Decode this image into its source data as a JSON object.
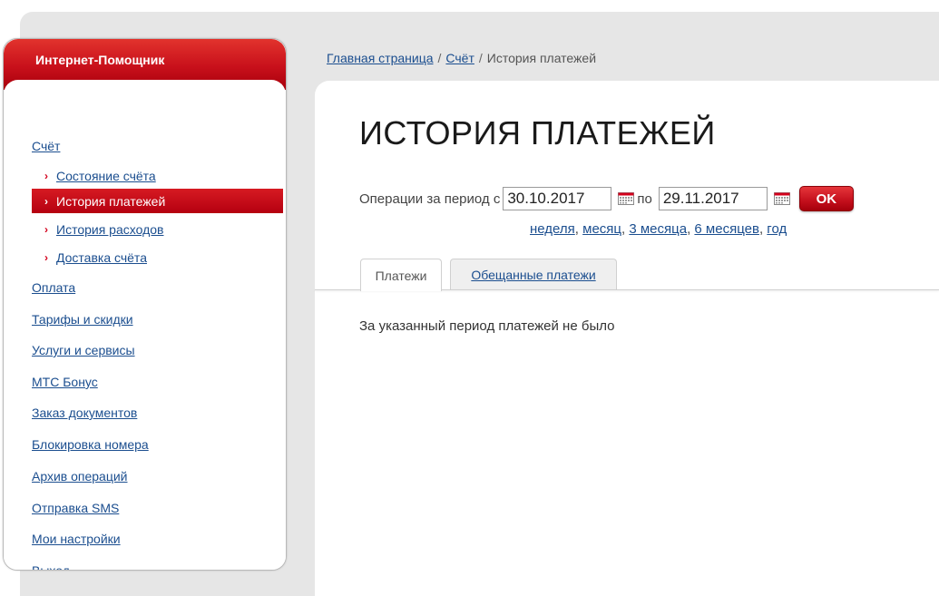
{
  "sidebar": {
    "title": "Интернет-Помощник",
    "items": [
      {
        "label": "Счёт"
      },
      {
        "label": "Оплата"
      },
      {
        "label": "Тарифы и скидки"
      },
      {
        "label": "Услуги и сервисы"
      },
      {
        "label": "МТС Бонус"
      },
      {
        "label": "Заказ документов"
      },
      {
        "label": "Блокировка номера"
      },
      {
        "label": "Архив операций"
      },
      {
        "label": "Отправка SMS"
      },
      {
        "label": "Мои настройки"
      },
      {
        "label": "Выход"
      }
    ],
    "sub_items": [
      {
        "label": "Состояние счёта",
        "active": false
      },
      {
        "label": "История платежей",
        "active": true
      },
      {
        "label": "История расходов",
        "active": false
      },
      {
        "label": "Доставка счёта",
        "active": false
      }
    ],
    "arrow_glyph": "›"
  },
  "breadcrumb": {
    "home": "Главная страница",
    "account": "Счёт",
    "current": "История платежей",
    "separator": "/"
  },
  "page": {
    "title": "ИСТОРИЯ ПЛАТЕЖЕЙ",
    "period_label": "Операции за период с",
    "date_from": "30.10.2017",
    "to_label": "по",
    "date_to": "29.11.2017",
    "ok_label": "OK",
    "quick_periods": [
      "неделя",
      "месяц",
      "3 месяца",
      "6 месяцев",
      "год"
    ],
    "tabs": [
      {
        "label": "Платежи",
        "active": true
      },
      {
        "label": "Обещанные платежи",
        "active": false
      }
    ],
    "empty_message": "За указанный период платежей не было"
  },
  "icons": {
    "calendar": "calendar-icon",
    "arrow": "chevron-right-icon"
  },
  "colors": {
    "brand_red": "#c8101b",
    "link_blue": "#1b4e8f",
    "background_gray": "#e6e6e6"
  }
}
